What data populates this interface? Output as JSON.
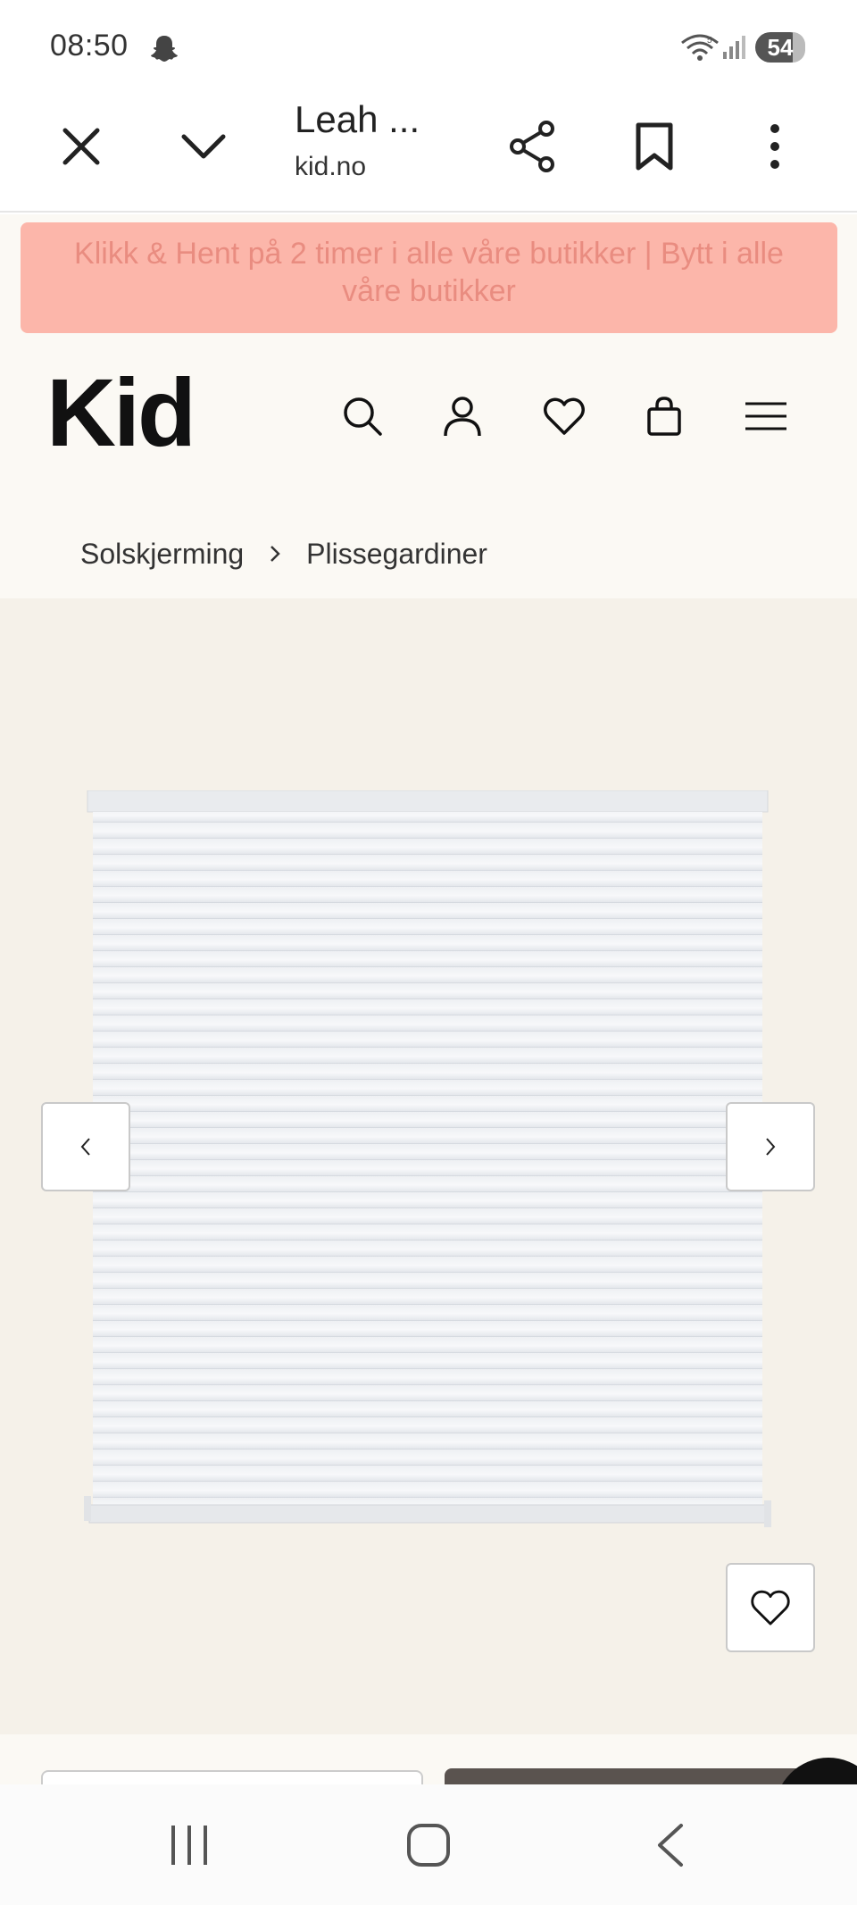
{
  "status_bar": {
    "time": "08:50",
    "battery": "54",
    "icons": [
      "snapchat-ghost-icon",
      "wifi-icon",
      "signal-icon"
    ]
  },
  "browser": {
    "title": "Leah ...",
    "domain": "kid.no",
    "icons": [
      "close-icon",
      "chevron-down-icon",
      "share-icon",
      "bookmark-icon",
      "more-vert-icon"
    ]
  },
  "promo": {
    "text": "Klikk & Hent på 2 timer i alle våre butikker | Bytt i alle våre butikker",
    "bg_color": "#fcb6aa",
    "text_color": "#e98c80"
  },
  "header": {
    "logo": "Kid",
    "icons": [
      "search-icon",
      "account-icon",
      "heart-icon",
      "shopping-bag-icon",
      "menu-icon"
    ]
  },
  "breadcrumb": {
    "items": [
      "Solskjerming",
      "Plissegardiner"
    ]
  },
  "gallery": {
    "bg_color": "#f5f1e9",
    "product_image": "white-pleated-blind",
    "prev_label": "‹",
    "next_label": "›"
  },
  "system_nav": {
    "icons": [
      "recents-icon",
      "home-icon",
      "back-icon"
    ]
  }
}
